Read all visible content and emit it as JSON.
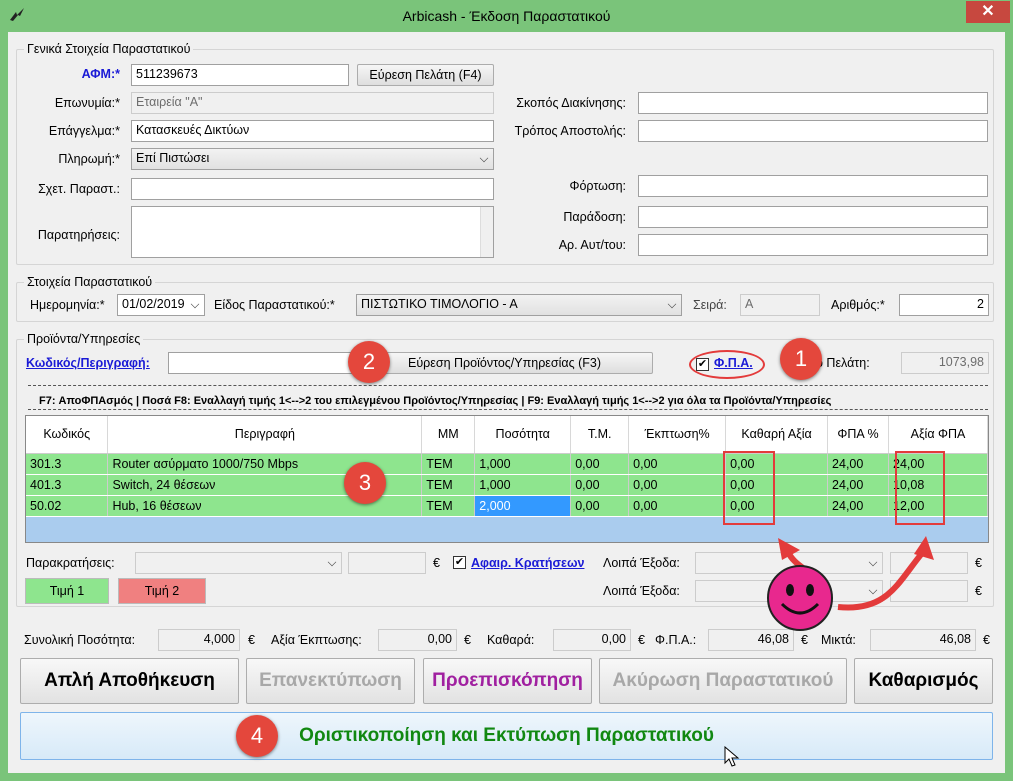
{
  "window": {
    "title": "Arbicash - Έκδοση Παραστατικού",
    "close": "✕"
  },
  "general": {
    "title": "Γενικά Στοιχεία Παραστατικού",
    "afm_label": "ΑΦΜ:*",
    "afm_value": "511239673",
    "find_customer": "Εύρεση Πελάτη (F4)",
    "name_label": "Επωνυμία:*",
    "name_value": "Εταιρεία \"Α\"",
    "job_label": "Επάγγελμα:*",
    "job_value": "Κατασκευές Δικτύων",
    "payment_label": "Πληρωμή:*",
    "payment_value": "Επί Πιστώσει",
    "related_label": "Σχετ. Παραστ.:",
    "related_value": "",
    "notes_label": "Παρατηρήσεις:",
    "notes_value": "",
    "purpose_label": "Σκοπός Διακίνησης:",
    "purpose_value": "",
    "shipping_label": "Τρόπος Αποστολής:",
    "shipping_value": "",
    "loading_label": "Φόρτωση:",
    "loading_value": "",
    "delivery_label": "Παράδοση:",
    "delivery_value": "",
    "vehicle_label": "Αρ. Αυτ/του:",
    "vehicle_value": ""
  },
  "invoice": {
    "title": "Στοιχεία Παραστατικού",
    "date_label": "Ημερομηνία:*",
    "date_value": "01/02/2019",
    "type_label": "Είδος Παραστατικού:*",
    "type_value": "ΠΙΣΤΩΤΙΚΟ ΤΙΜΟΛΟΓΙΟ - Α",
    "series_label": "Σειρά:",
    "series_value": "Α",
    "number_label": "Αριθμός:*",
    "number_value": "2"
  },
  "products": {
    "title": "Προϊόντα/Υπηρεσίες",
    "code_label": "Κωδικός/Περιγραφή:",
    "code_value": "",
    "find_product": "Εύρεση Προϊόντος/Υπηρεσίας (F3)",
    "vat_label": "Φ.Π.Α.",
    "balance_label": "ο Πελάτη:",
    "balance_value": "1073,98",
    "shortcuts": "F7: ΑποΦΠΑσμός   |   Ποσά F8: Εναλλαγή τιμής 1<-->2 του επιλεγμένου Προϊόντος/Υπηρεσίας   |   F9: Εναλλαγή τιμής 1<-->2 για όλα τα Προϊόντα/Υπηρεσίες",
    "columns": [
      "Κωδικός",
      "Περιγραφή",
      "ΜΜ",
      "Ποσότητα",
      "Τ.Μ.",
      "Έκπτωση%",
      "Καθαρή Αξία",
      "ΦΠΑ %",
      "Αξία ΦΠΑ"
    ],
    "rows": [
      [
        "301.3",
        "Router ασύρματο 1000/750 Mbps",
        "TEM",
        "1,000",
        "0,00",
        "0,00",
        "0,00",
        "24,00",
        "24,00"
      ],
      [
        "401.3",
        "Switch, 24 θέσεων",
        "TEM",
        "1,000",
        "0,00",
        "0,00",
        "0,00",
        "24,00",
        "10,08"
      ],
      [
        "50.02",
        "Hub, 16 θέσεων",
        "TEM",
        "2,000",
        "0,00",
        "0,00",
        "0,00",
        "24,00",
        "12,00"
      ]
    ],
    "withholding_label": "Παρακρατήσεις:",
    "withholding_value": "",
    "euro": "€",
    "deduct_label": "Αφαιρ. Κρατήσεων",
    "other1_label": "Λοιπά Έξοδα:",
    "other2_label": "Λοιπά Έξοδα:",
    "price1": "Τιμή 1",
    "price2": "Τιμή 2"
  },
  "totals": {
    "qty_label": "Συνολική Ποσότητα:",
    "qty_value": "4,000",
    "discount_label": "Αξία Έκπτωσης:",
    "discount_value": "0,00",
    "net_label": "Καθαρά:",
    "net_value": "0,00",
    "vat_label": "Φ.Π.Α.:",
    "vat_value": "46,08",
    "gross_label": "Μικτά:",
    "gross_value": "46,08"
  },
  "actions": {
    "save": "Απλή Αποθήκευση",
    "reprint": "Επανεκτύπωση",
    "preview": "Προεπισκόπηση",
    "cancel": "Ακύρωση Παραστατικού",
    "clear": "Καθαρισμός",
    "finalize": "Οριστικοποίηση και Εκτύπωση Παραστατικού"
  },
  "annotations": [
    "1",
    "2",
    "3",
    "4"
  ],
  "colors": {
    "title_bar": "#7ac47a",
    "row_green": "#8ee58e",
    "accent_red": "#e4473c",
    "link_blue": "#1a1ad6",
    "preview_purple": "#a020a0",
    "finalize_green": "#118811"
  }
}
